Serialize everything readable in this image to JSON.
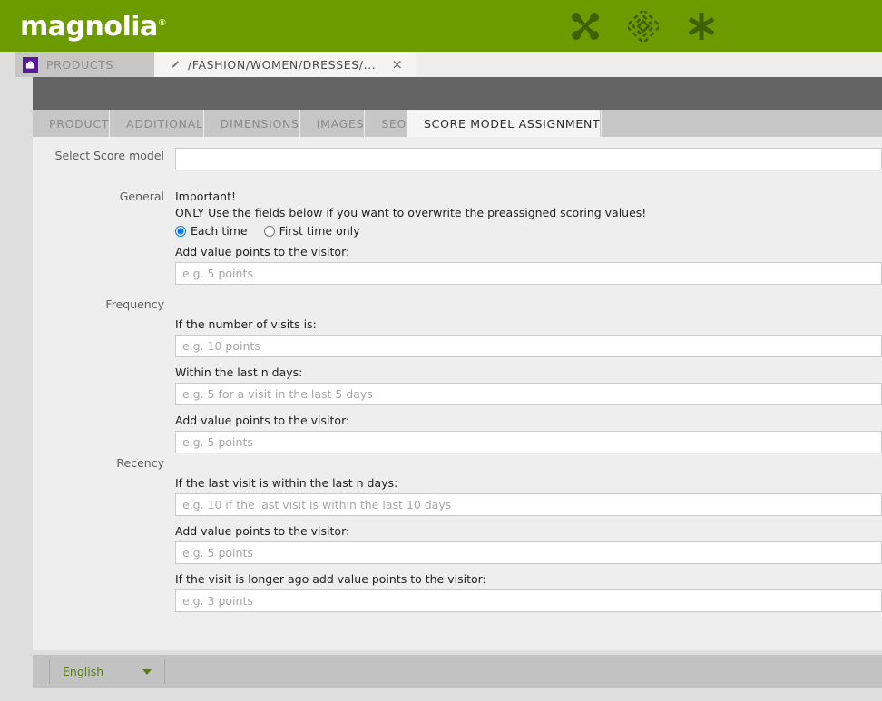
{
  "header": {
    "logo_text": "magnolia",
    "logo_trademark": "®",
    "icons": [
      {
        "name": "pulse-nodes-icon"
      },
      {
        "name": "pattern-grid-icon"
      },
      {
        "name": "asterisk-icon"
      }
    ]
  },
  "window_tabs": [
    {
      "label": "PRODUCTS",
      "icon": "basket-icon",
      "active": false
    },
    {
      "label": "/FASHION/WOMEN/DRESSES/...",
      "icon": "pencil-icon",
      "active": true,
      "close_label": "×"
    }
  ],
  "form_tabs": [
    {
      "label": "PRODUCT",
      "active": false
    },
    {
      "label": "ADDITIONAL",
      "active": false
    },
    {
      "label": "DIMENSIONS",
      "active": false
    },
    {
      "label": "IMAGES",
      "active": false
    },
    {
      "label": "SEO",
      "active": false
    },
    {
      "label": "SCORE MODEL ASSIGNMENT",
      "active": true
    }
  ],
  "form": {
    "score_model": {
      "label": "Select Score model",
      "value": "",
      "placeholder": ""
    },
    "general": {
      "label": "General",
      "notice_title": "Important!",
      "notice_text": "ONLY Use the fields below if you want to overwrite the preassigned scoring values!",
      "radios": [
        {
          "label": "Each time",
          "checked": true
        },
        {
          "label": "First time only",
          "checked": false
        }
      ],
      "add_points_label": "Add value points to the visitor:",
      "add_points_placeholder": "e.g. 5 points",
      "add_points_value": ""
    },
    "frequency": {
      "label": "Frequency",
      "fields": [
        {
          "label": "If the number of visits is:",
          "placeholder": "e.g. 10 points",
          "value": ""
        },
        {
          "label": "Within the last n days:",
          "placeholder": "e.g. 5 for a visit in the last 5 days",
          "value": ""
        },
        {
          "label": "Add value points to the visitor:",
          "placeholder": "e.g. 5 points",
          "value": ""
        }
      ]
    },
    "recency": {
      "label": "Recency",
      "fields": [
        {
          "label": "If the last visit is within the last n days:",
          "placeholder": "e.g. 10 if the last visit is within the last 10 days",
          "value": ""
        },
        {
          "label": "Add value points to the visitor:",
          "placeholder": "e.g. 5 points",
          "value": ""
        },
        {
          "label": "If the visit is longer ago add value points to the visitor:",
          "placeholder": "e.g. 3 points",
          "value": ""
        }
      ]
    }
  },
  "footer": {
    "language": "English"
  },
  "colors": {
    "brand_green": "#6c9b00",
    "icon_green": "#3f6000",
    "panel_bg": "#eeeeee",
    "dark_bar": "#646464",
    "tab_inactive": "#c6c6c6",
    "tab_active": "#f4f4f4",
    "footer_bg": "#c2c2c2",
    "link_green": "#5b7a1f",
    "products_icon_purple": "#5a189a"
  }
}
